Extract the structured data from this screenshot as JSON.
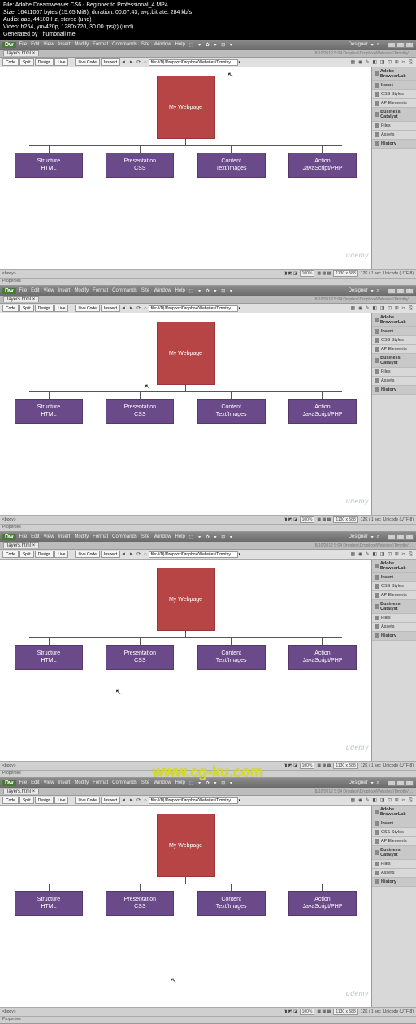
{
  "overlay": {
    "line1": "File: Adobe Dreamweaver CS6 - Beginner to Professional_4.MP4",
    "line2": "Size: 16411007 bytes (15.65 MiB), duration: 00:07:43, avg.bitrate: 284 kb/s",
    "line3": "Audio: aac, 44100 Hz, stereo (und)",
    "line4": "Video: h264, yuv420p, 1280x720, 30.00 fps(r) (und)",
    "line5": "Generated by Thumbnail me"
  },
  "menu": {
    "items": [
      "File",
      "Edit",
      "View",
      "Insert",
      "Modify",
      "Format",
      "Commands",
      "Site",
      "Window",
      "Help"
    ],
    "layout_label": "Designer",
    "search_placeholder": "⌕"
  },
  "doc": {
    "tab_name": "layers.html",
    "close": "×",
    "timestamp": "8/10/2012 5:04 Dropbox\\Dropbox\\Websites\\Timothy\\..."
  },
  "viewbar": {
    "code": "Code",
    "split": "Split",
    "design": "Design",
    "live": "Live",
    "livecode": "Live Code",
    "inspect": "Inspect",
    "address_prefix": "file:///D|/Dropbox/Dropbox/Websites/Timothy",
    "nav_icons": "◄ ► ⟳ ⌂",
    "tool_icons": "▦ ◉ ✎ ◧ ◨ ⊡ ⊞ ✂ ⎘"
  },
  "panels": {
    "browserlab": "Adobe BrowserLab",
    "insert": "Insert",
    "css_styles": "CSS Styles",
    "ap_elements": "AP Elements",
    "bc": "Business Catalyst",
    "files": "Files",
    "assets": "Assets",
    "history": "History"
  },
  "diagram": {
    "title": "My Webpage",
    "boxes": [
      {
        "l1": "Structure",
        "l2": "HTML"
      },
      {
        "l1": "Presentation",
        "l2": "CSS"
      },
      {
        "l1": "Content",
        "l2": "Text/Images"
      },
      {
        "l1": "Action",
        "l2": "JavaScript/PHP"
      }
    ]
  },
  "status": {
    "body": "<body>",
    "zoom": "100%",
    "grid_icons": "▦ ▦ ▦",
    "dims": "1130 x 588",
    "size": "12K / 1 sec",
    "enc": "Unicode (UTF-8)"
  },
  "properties_label": "Properties",
  "udemy_label": "udemy",
  "watermark": "www.cg-ku.com",
  "icons": {
    "toolbar": "⬚ ▾ ✿ ▾ ⊞ ▾"
  }
}
